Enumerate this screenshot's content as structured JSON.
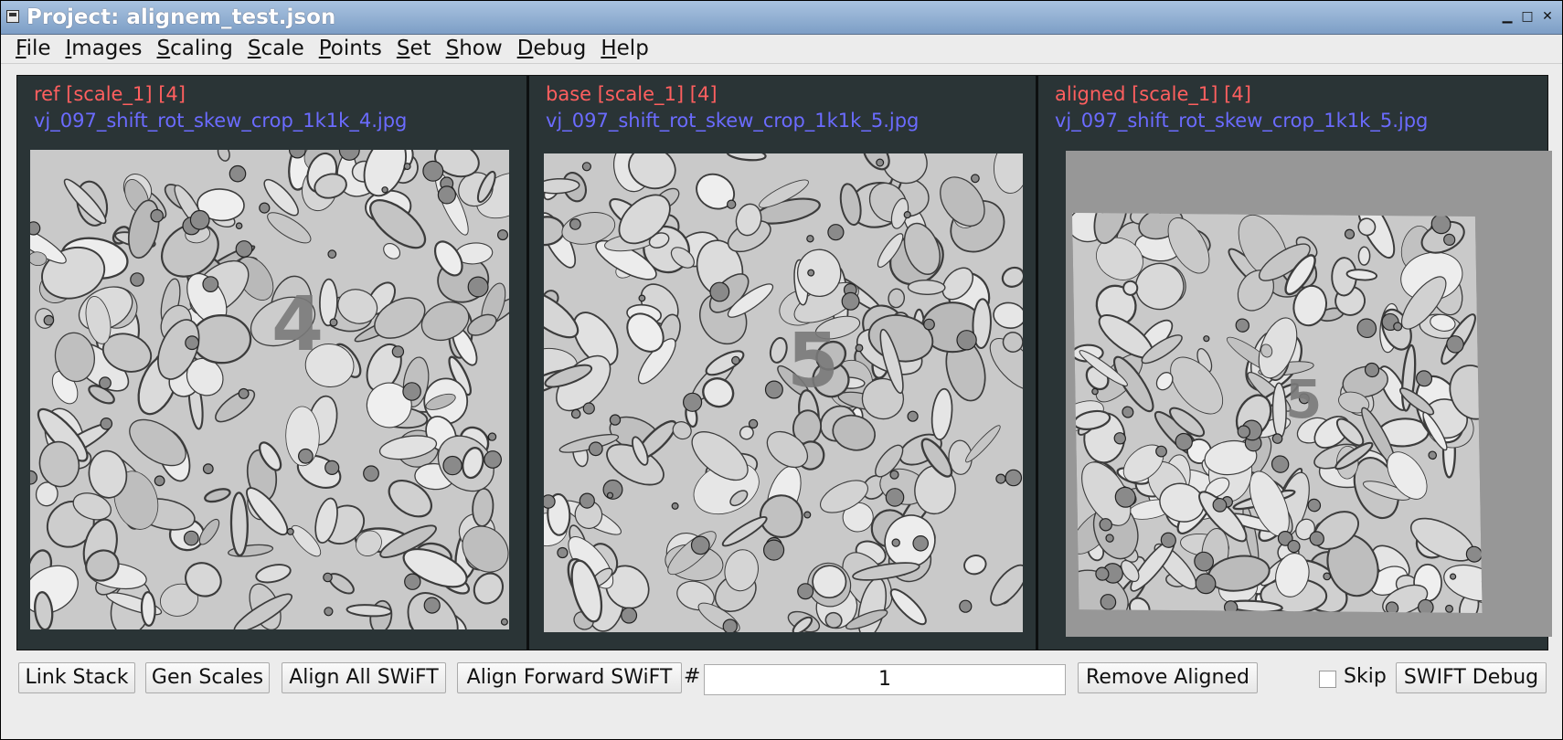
{
  "window": {
    "title": "Project: alignem_test.json"
  },
  "menu": [
    {
      "label": "File",
      "mnemonic_index": 0
    },
    {
      "label": "Images",
      "mnemonic_index": 0
    },
    {
      "label": "Scaling",
      "mnemonic_index": 0
    },
    {
      "label": "Scale",
      "mnemonic_index": 0
    },
    {
      "label": "Points",
      "mnemonic_index": 0
    },
    {
      "label": "Set",
      "mnemonic_index": 0
    },
    {
      "label": "Show",
      "mnemonic_index": 0
    },
    {
      "label": "Debug",
      "mnemonic_index": 0
    },
    {
      "label": "Help",
      "mnemonic_index": 0
    }
  ],
  "panels": [
    {
      "label": "ref [scale_1] [4]",
      "file": "vj_097_shift_rot_skew_crop_1k1k_4.jpg",
      "overlay_number": "4"
    },
    {
      "label": "base [scale_1] [4]",
      "file": "vj_097_shift_rot_skew_crop_1k1k_5.jpg",
      "overlay_number": "5"
    },
    {
      "label": "aligned [scale_1] [4]",
      "file": "vj_097_shift_rot_skew_crop_1k1k_5.jpg",
      "overlay_number": "5"
    }
  ],
  "controls": {
    "link_stack": "Link Stack",
    "gen_scales": "Gen Scales",
    "align_all": "Align All SWiFT",
    "align_forward": "Align Forward SWiFT",
    "hash_label": "#",
    "num_value": "1",
    "remove_aligned": "Remove Aligned",
    "skip_label": "Skip",
    "skip_checked": false,
    "swift_debug": "SWIFT Debug"
  },
  "colors": {
    "panel_bg": "#2a3436",
    "label_red": "#ff5f5f",
    "file_blue": "#6b6bff",
    "aligned_bg": "#979797",
    "titlebar": "#7d9ec6"
  }
}
